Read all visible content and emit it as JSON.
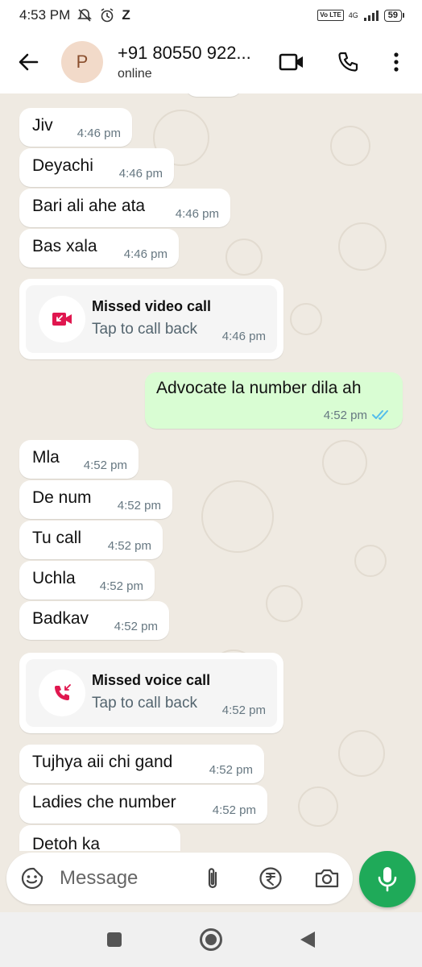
{
  "status_bar": {
    "time": "4:53 PM",
    "carrier_glyph": "Z",
    "volte": "Vo LTE",
    "network": "4G",
    "battery": "59"
  },
  "header": {
    "avatar_letter": "P",
    "name": "+91 80550 922...",
    "status": "online"
  },
  "messages": [
    {
      "text": "Jiv",
      "time": "4:46 pm"
    },
    {
      "text": "Deyachi",
      "time": "4:46 pm"
    },
    {
      "text": "Bari ali ahe ata",
      "time": "4:46 pm"
    },
    {
      "text": "Bas xala",
      "time": "4:46 pm"
    },
    {
      "text": "Advocate la number dila  ah",
      "time": "4:52 pm"
    },
    {
      "text": "Mla",
      "time": "4:52 pm"
    },
    {
      "text": "De num",
      "time": "4:52 pm"
    },
    {
      "text": "Tu call",
      "time": "4:52 pm"
    },
    {
      "text": "Uchla",
      "time": "4:52 pm"
    },
    {
      "text": "Badkav",
      "time": "4:52 pm"
    },
    {
      "text": "Tujhya aii chi gand",
      "time": "4:52 pm"
    },
    {
      "text": "Ladies che number",
      "time": "4:52 pm"
    },
    {
      "text": "Detoh ka",
      "time": ""
    }
  ],
  "missed_calls": [
    {
      "title": "Missed video call",
      "subtitle": "Tap to call back",
      "time": "4:46 pm",
      "icon": "missed-video-call-icon"
    },
    {
      "title": "Missed voice call",
      "subtitle": "Tap to call back",
      "time": "4:52 pm",
      "icon": "missed-voice-call-icon"
    }
  ],
  "input": {
    "placeholder": "Message"
  },
  "colors": {
    "outgoing_bubble": "#d9fdd3",
    "incoming_bubble": "#ffffff",
    "chat_background": "#efeae2",
    "mic_button": "#1faa59",
    "read_ticks": "#53bdeb",
    "missed_call_red": "#e0174f"
  }
}
